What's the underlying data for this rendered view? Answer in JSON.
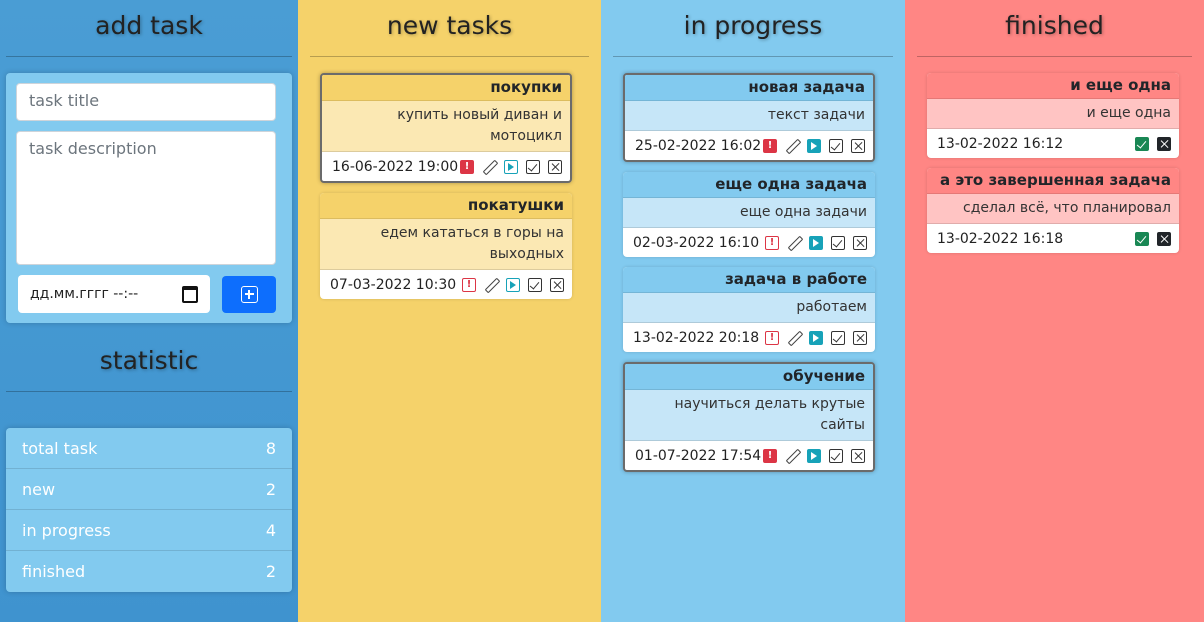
{
  "add": {
    "title": "add task",
    "title_placeholder": "task title",
    "description_placeholder": "task description",
    "date_value": "дд.мм.гггг --:--"
  },
  "statistic": {
    "title": "statistic",
    "items": [
      {
        "label": "total task",
        "count": "8"
      },
      {
        "label": "new",
        "count": "2"
      },
      {
        "label": "in progress",
        "count": "4"
      },
      {
        "label": "finished",
        "count": "2"
      }
    ]
  },
  "columns": {
    "new": {
      "title": "new tasks",
      "cards": [
        {
          "title": "покупки",
          "description": "купить новый диван и мотоцикл",
          "date": "16-06-2022 19:00"
        },
        {
          "title": "покатушки",
          "description": "едем кататься в горы на выходных",
          "date": "07-03-2022 10:30"
        }
      ]
    },
    "progress": {
      "title": "in progress",
      "cards": [
        {
          "title": "новая задача",
          "description": "текст задачи",
          "date": "25-02-2022 16:02"
        },
        {
          "title": "еще одна задача",
          "description": "еще одна задачи",
          "date": "02-03-2022 16:10"
        },
        {
          "title": "задача в работе",
          "description": "работаем",
          "date": "13-02-2022 20:18"
        },
        {
          "title": "обучение",
          "description": "научиться делать крутые сайты",
          "date": "01-07-2022 17:54"
        }
      ]
    },
    "finished": {
      "title": "finished",
      "cards": [
        {
          "title": "и еще одна",
          "description": "и еще одна",
          "date": "13-02-2022 16:12"
        },
        {
          "title": "а это завершенная задача",
          "description": "сделал всё, что планировал",
          "date": "13-02-2022 16:18"
        }
      ]
    }
  },
  "colors": {
    "add_column": "#4a9dd4",
    "new_column": "#f5d26a",
    "progress_column": "#82caef",
    "finished_column": "#ff8684",
    "add_button": "#0d6efd"
  }
}
